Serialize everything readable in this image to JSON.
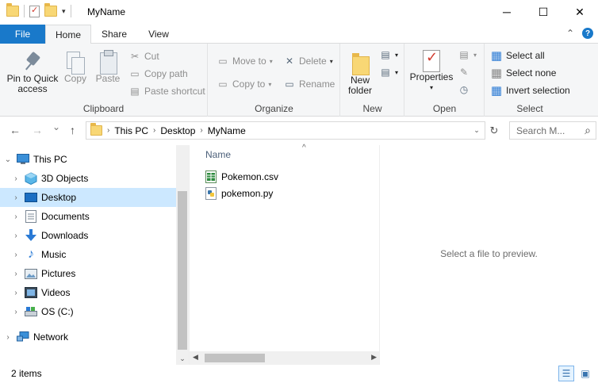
{
  "window": {
    "title": "MyName",
    "minimize_glyph": "─",
    "maximize_glyph": "☐",
    "close_glyph": "✕"
  },
  "qat": {
    "dropdown_glyph": "▾"
  },
  "ribbon_tabs": {
    "file": "File",
    "home": "Home",
    "share": "Share",
    "view": "View",
    "collapse_glyph": "⌃",
    "help_glyph": "?"
  },
  "ribbon": {
    "clipboard": {
      "label": "Clipboard",
      "pin_label_1": "Pin to Quick",
      "pin_label_2": "access",
      "copy": "Copy",
      "paste": "Paste",
      "cut": "Cut",
      "copy_path": "Copy path",
      "paste_shortcut": "Paste shortcut"
    },
    "organize": {
      "label": "Organize",
      "move_to": "Move to",
      "copy_to": "Copy to",
      "delete": "Delete",
      "rename": "Rename"
    },
    "new": {
      "label": "New",
      "new_folder_1": "New",
      "new_folder_2": "folder"
    },
    "open": {
      "label": "Open",
      "properties": "Properties"
    },
    "select": {
      "label": "Select",
      "select_all": "Select all",
      "select_none": "Select none",
      "invert_selection": "Invert selection"
    }
  },
  "address": {
    "back_glyph": "←",
    "forward_glyph": "→",
    "recent_glyph": "⌄",
    "up_glyph": "↑",
    "crumbs": [
      "This PC",
      "Desktop",
      "MyName"
    ],
    "refresh_glyph": "↻",
    "search_placeholder": "Search M...",
    "search_glyph": "⌕"
  },
  "nav": {
    "items": [
      {
        "label": "This PC"
      },
      {
        "label": "3D Objects"
      },
      {
        "label": "Desktop"
      },
      {
        "label": "Documents"
      },
      {
        "label": "Downloads"
      },
      {
        "label": "Music"
      },
      {
        "label": "Pictures"
      },
      {
        "label": "Videos"
      },
      {
        "label": "OS (C:)"
      },
      {
        "label": "Network"
      }
    ]
  },
  "files": {
    "column_name": "Name",
    "sort_glyph": "^",
    "items": [
      {
        "name": "Pokemon.csv",
        "icon": "csv-file-icon"
      },
      {
        "name": "pokemon.py",
        "icon": "python-file-icon"
      }
    ]
  },
  "preview": {
    "text": "Select a file to preview."
  },
  "status": {
    "item_count": "2 items"
  }
}
